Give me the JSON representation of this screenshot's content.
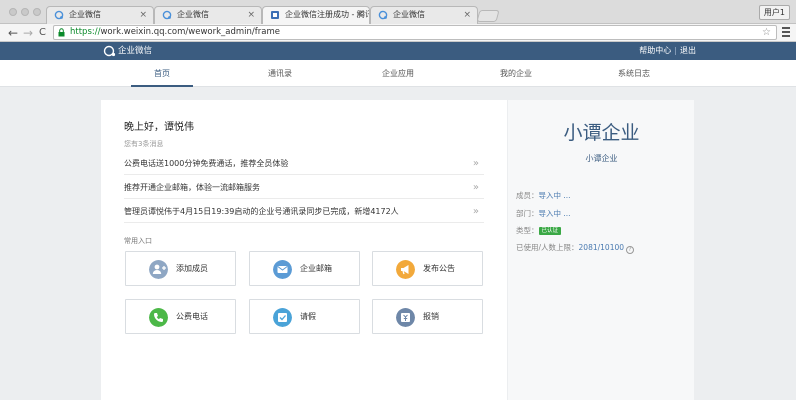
{
  "browser": {
    "tabs": [
      {
        "title": "企业微信",
        "close": "×"
      },
      {
        "title": "企业微信",
        "close": "×"
      },
      {
        "title": "企业微信注册成功 - 腾讯企...",
        "close": "×"
      },
      {
        "title": "企业微信",
        "close": "×"
      }
    ],
    "user_button": "用户1",
    "url_scheme": "https://",
    "url_rest": "work.weixin.qq.com/wework_admin/frame",
    "back": "←",
    "forward": "→",
    "reload": "C",
    "star": "☆"
  },
  "header": {
    "logo_text": "企业微信",
    "help": "帮助中心",
    "separator": "|",
    "logout": "退出"
  },
  "nav": {
    "items": [
      "首页",
      "通讯录",
      "企业应用",
      "我的企业",
      "系统日志"
    ],
    "active": "首页"
  },
  "main": {
    "greeting": "晚上好，谭悦伟",
    "message_count": "您有3条消息",
    "messages": [
      "公费电话送1000分钟免费通话，推荐全员体验",
      "推荐开通企业邮箱，体验一流邮箱服务",
      "管理员谭悦伟于4月15日19:39启动的企业号通讯录同步已完成，新增4172人"
    ],
    "arrow": "»",
    "common_entry": "常用入口",
    "cards": [
      {
        "label": "添加成员",
        "icon": "add-member-icon",
        "color": "#8fa7c4"
      },
      {
        "label": "企业邮箱",
        "icon": "mail-icon",
        "color": "#5b9bd5"
      },
      {
        "label": "发布公告",
        "icon": "announcement-icon",
        "color": "#f2a93b"
      },
      {
        "label": "公费电话",
        "icon": "phone-icon",
        "color": "#4cb848"
      },
      {
        "label": "请假",
        "icon": "leave-request-icon",
        "color": "#4aa3d8"
      },
      {
        "label": "报销",
        "icon": "reimbursement-icon",
        "color": "#6e87a8"
      }
    ]
  },
  "company": {
    "name": "小谭企业",
    "short_name": "小谭企业",
    "members_label": "成员：",
    "members_value": "导入中 ...",
    "departments_label": "部门：",
    "departments_value": "导入中 ...",
    "type_label": "类型：",
    "type_badge": "已认证",
    "usage_label": "已使用/人数上限：",
    "usage_value": "2081/10100",
    "help_glyph": "?"
  }
}
